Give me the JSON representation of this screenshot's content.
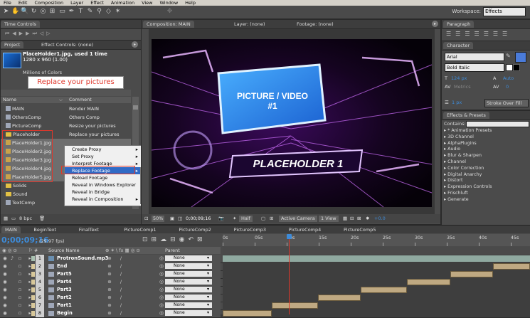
{
  "menubar": {
    "items": [
      "File",
      "Edit",
      "Composition",
      "Layer",
      "Effect",
      "Animation",
      "View",
      "Window",
      "Help"
    ]
  },
  "workspace": {
    "label": "Workspace:",
    "value": "Effects"
  },
  "timecontrols": {
    "tab": "Time Controls"
  },
  "project": {
    "tab": "Project",
    "effect_tab": "Effect Controls: (none)",
    "selected_name": "PlaceHolder1.jpg",
    "selected_used": ", used 1 time",
    "selected_dims": "1280 x 960 (1.00)",
    "selected_colors": "Millions of Colors",
    "annotation": "Replace your pictures",
    "col_name": "Name",
    "col_comment": "Comment",
    "rows": [
      {
        "name": "MAIN",
        "comment": "Render MAIN",
        "type": "comp"
      },
      {
        "name": "OthersComp",
        "comment": "Others Comp",
        "type": "comp"
      },
      {
        "name": "PictureComp",
        "comment": "Resize your pictures",
        "type": "comp"
      },
      {
        "name": "Placeholder",
        "comment": "Replace your pictures",
        "type": "folder"
      },
      {
        "name": "PlaceHolder1.jpg",
        "comment": "",
        "type": "file"
      },
      {
        "name": "PlaceHolder2.jpg",
        "comment": "",
        "type": "file"
      },
      {
        "name": "PlaceHolder3.jpg",
        "comment": "",
        "type": "file"
      },
      {
        "name": "PlaceHolder4.jpg",
        "comment": "",
        "type": "file"
      },
      {
        "name": "PlaceHolder5.jpg",
        "comment": "",
        "type": "file"
      },
      {
        "name": "Solids",
        "comment": "",
        "type": "folder"
      },
      {
        "name": "Sound",
        "comment": "",
        "type": "folder"
      },
      {
        "name": "TextComp",
        "comment": "",
        "type": "comp"
      }
    ],
    "bpc": "8 bpc"
  },
  "context_menu": {
    "items": [
      {
        "label": "Create Proxy",
        "arrow": true
      },
      {
        "label": "Set Proxy",
        "arrow": true
      },
      {
        "label": "Interpret Footage",
        "arrow": true
      },
      {
        "label": "Replace Footage",
        "arrow": true
      },
      {
        "label": "Reload Footage",
        "arrow": false
      },
      {
        "label": "Reveal in Windows Explorer",
        "arrow": false
      },
      {
        "label": "Reveal in Bridge",
        "arrow": false
      },
      {
        "label": "Reveal in Composition",
        "arrow": true
      }
    ],
    "sub": [
      {
        "label": "File...",
        "shortcut": "Ctrl+H"
      },
      {
        "label": "With Layered Comp",
        "shortcut": ""
      },
      {
        "label": "Placeholder...",
        "shortcut": ""
      },
      {
        "label": "Solid...",
        "shortcut": ""
      }
    ]
  },
  "viewer": {
    "tab": "Composition: MAIN",
    "layer_tab": "Layer: (none)",
    "footage_tab": "Footage: (none)",
    "picture_text": "PICTURE / VIDEO",
    "picture_num": "#1",
    "placeholder_text": "PLACEHOLDER 1",
    "zoom": "50%",
    "timecode": "0;00;09;16",
    "res": "Half",
    "camera": "Active Camera",
    "views": "1 View",
    "exposure": "+0.0"
  },
  "paragraph": {
    "tab": "Paragraph"
  },
  "character": {
    "tab": "Character",
    "font": "Arial",
    "style": "Bold Italic",
    "size": "124 px",
    "leading": "Auto",
    "tracking_label": "Metrics",
    "tracking": "0",
    "stroke": "1 px",
    "stroke_type": "Stroke Over Fill"
  },
  "effects": {
    "tab": "Effects & Presets",
    "contains_label": "Contains:",
    "items": [
      "* Animation Presets",
      "3D Channel",
      "AlphaPlugins",
      "Audio",
      "Blur & Sharpen",
      "Channel",
      "Color Correction",
      "Digital Anarchy",
      "Distort",
      "Expression Controls",
      "Frischluft",
      "Generate"
    ]
  },
  "timeline": {
    "tabs": [
      "MAIN",
      "BeginText",
      "FinalText",
      "PictureComp1",
      "PictureComp2",
      "PictureComp3",
      "PictureComp4",
      "PictureComp5"
    ],
    "timecode": "0;00;09;16",
    "fps": "(29.97 fps)",
    "col_source": "Source Name",
    "col_parent": "Parent",
    "ruler": [
      "0s",
      "05s",
      "10s",
      "15s",
      "20s",
      "25s",
      "30s",
      "35s",
      "40s",
      "45s"
    ],
    "layers": [
      {
        "num": "1",
        "name": "ProtronSound.mp3",
        "parent": "None",
        "bar_start": 0,
        "bar_end": 1,
        "audio": true
      },
      {
        "num": "2",
        "name": "End",
        "parent": "None",
        "bar_start": 0.88,
        "bar_end": 1,
        "audio": false
      },
      {
        "num": "3",
        "name": "Part5",
        "parent": "None",
        "bar_start": 0.74,
        "bar_end": 0.88,
        "audio": false
      },
      {
        "num": "4",
        "name": "Part4",
        "parent": "None",
        "bar_start": 0.6,
        "bar_end": 0.74,
        "audio": false
      },
      {
        "num": "5",
        "name": "Part3",
        "parent": "None",
        "bar_start": 0.45,
        "bar_end": 0.6,
        "audio": false
      },
      {
        "num": "6",
        "name": "Part2",
        "parent": "None",
        "bar_start": 0.31,
        "bar_end": 0.45,
        "audio": false
      },
      {
        "num": "7",
        "name": "Part1",
        "parent": "None",
        "bar_start": 0.16,
        "bar_end": 0.31,
        "audio": false
      },
      {
        "num": "8",
        "name": "Begin",
        "parent": "None",
        "bar_start": 0,
        "bar_end": 0.16,
        "audio": false
      }
    ],
    "playhead_frac": 0.215
  },
  "colors": {
    "accent_red": "#e0372b",
    "highlight": "#316ac5",
    "timecode": "#3d8bd9"
  }
}
